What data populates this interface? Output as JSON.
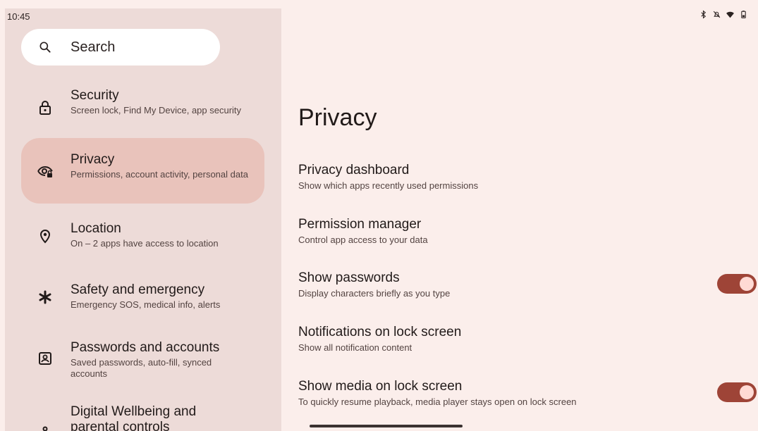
{
  "status_bar": {
    "time": "10:45",
    "icons": [
      "bluetooth-icon",
      "mute-icon",
      "wifi-icon",
      "battery-icon"
    ]
  },
  "search": {
    "label": "Search",
    "icon": "search-icon"
  },
  "sidebar": {
    "items": [
      {
        "icon": "lock-icon",
        "title": "Security",
        "subtitle": "Screen lock, Find My Device, app security"
      },
      {
        "icon": "privacy-eye-icon",
        "title": "Privacy",
        "subtitle": "Permissions, account activity, personal data",
        "selected": true
      },
      {
        "icon": "location-pin-icon",
        "title": "Location",
        "subtitle": "On – 2 apps have access to location"
      },
      {
        "icon": "asterisk-icon",
        "title": "Safety and emergency",
        "subtitle": "Emergency SOS, medical info, alerts"
      },
      {
        "icon": "account-box-icon",
        "title": "Passwords and accounts",
        "subtitle": "Saved passwords, auto-fill, synced accounts"
      },
      {
        "icon": "wellbeing-icon",
        "title": "Digital Wellbeing and parental controls",
        "subtitle": ""
      }
    ]
  },
  "main": {
    "title": "Privacy",
    "preferences": [
      {
        "title": "Privacy dashboard",
        "subtitle": "Show which apps recently used permissions"
      },
      {
        "title": "Permission manager",
        "subtitle": "Control app access to your data"
      },
      {
        "title": "Show passwords",
        "subtitle": "Display characters briefly as you type",
        "toggle": true,
        "on": true
      },
      {
        "title": "Notifications on lock screen",
        "subtitle": "Show all notification content"
      },
      {
        "title": "Show media on lock screen",
        "subtitle": "To quickly resume playback, media player stays open on lock screen",
        "toggle": true,
        "on": true
      }
    ]
  },
  "colors": {
    "accent": "#9e4437",
    "selected_bg": "#e9c3bb",
    "sidebar_bg": "#eddbd8",
    "main_bg": "#fbeeeb"
  }
}
